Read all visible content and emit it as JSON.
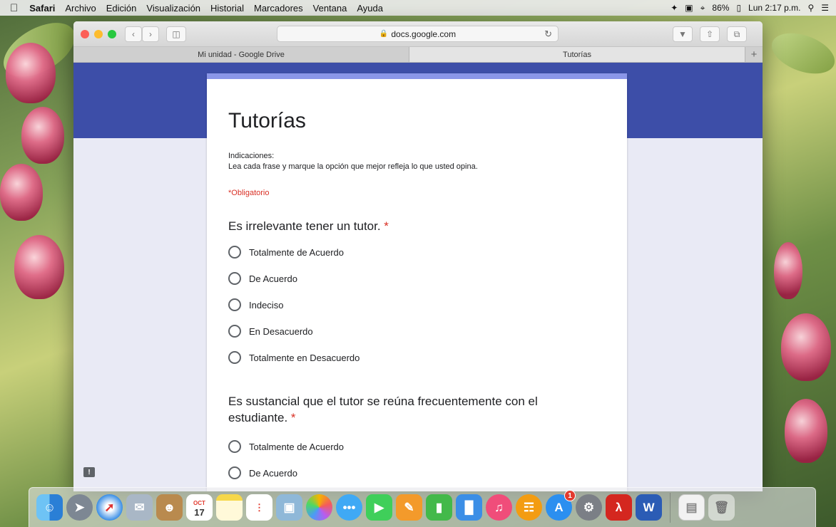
{
  "menubar": {
    "apple": "",
    "items": [
      "Safari",
      "Archivo",
      "Edición",
      "Visualización",
      "Historial",
      "Marcadores",
      "Ventana",
      "Ayuda"
    ],
    "battery": "86%",
    "clock": "Lun 2:17 p.m."
  },
  "browser": {
    "address": "docs.google.com",
    "tabs": [
      "Mi unidad - Google Drive",
      "Tutorías"
    ],
    "new_tab": "+"
  },
  "form": {
    "title": "Tutorías",
    "instructions_title": "Indicaciones:",
    "instructions": "Lea cada frase y marque la opción que mejor refleja lo que usted opina.",
    "required_note": "*Obligatorio",
    "questions": [
      {
        "text": "Es irrelevante tener un tutor.",
        "star": "*",
        "options": [
          "Totalmente de Acuerdo",
          "De Acuerdo",
          "Indeciso",
          "En Desacuerdo",
          "Totalmente en Desacuerdo"
        ]
      },
      {
        "text_line1": "Es sustancial que el tutor se reúna frecuentemente con el",
        "text_line2": "estudiante.",
        "star": "*",
        "options": [
          "Totalmente de Acuerdo",
          "De Acuerdo"
        ]
      }
    ]
  },
  "dock": {
    "items": [
      "finder",
      "launchpad",
      "safari",
      "photo-mail",
      "contacts",
      "calendar",
      "notes",
      "reminders",
      "preview",
      "photos",
      "messages",
      "facetime",
      "pages",
      "numbers",
      "keynote",
      "itunes",
      "ibooks",
      "app-store",
      "system-preferences",
      "acrobat",
      "word",
      "document",
      "trash"
    ],
    "calendar_month": "OCT",
    "calendar_day": "17",
    "appstore_badge": "1"
  }
}
